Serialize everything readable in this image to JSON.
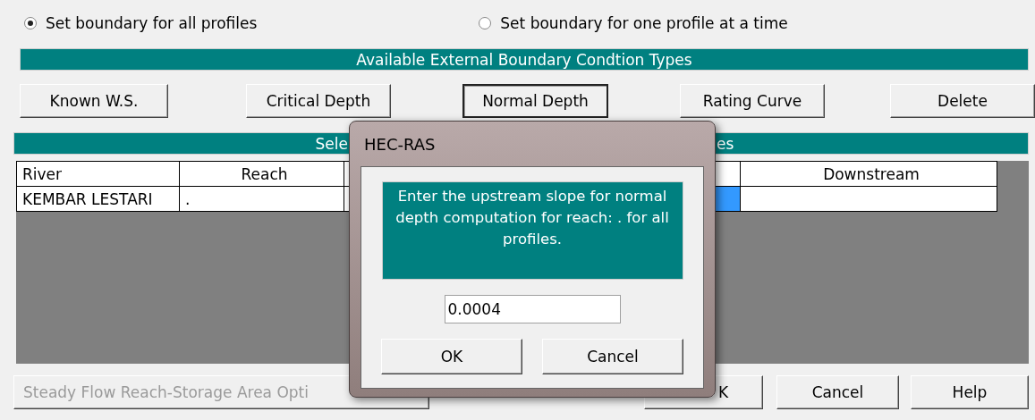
{
  "boundary_mode": [
    {
      "label": "Set boundary for all profiles",
      "selected": true
    },
    {
      "label": "Set boundary for one profile at a time",
      "selected": false
    }
  ],
  "types_header": "Available External Boundary Condtion Types",
  "type_buttons": [
    {
      "label": "Known W.S.",
      "pressed": false
    },
    {
      "label": "Critical Depth",
      "pressed": false
    },
    {
      "label": "Normal Depth",
      "pressed": true
    },
    {
      "label": "Rating Curve",
      "pressed": false
    },
    {
      "label": "Delete",
      "pressed": false
    }
  ],
  "locations_header": {
    "left": "Sele",
    "right": "es"
  },
  "table": {
    "columns": [
      "River",
      "Reach",
      "",
      "Downstream"
    ],
    "rows": [
      {
        "cells": [
          "KEMBAR LESTARI",
          "."
        ],
        "selected": true
      }
    ]
  },
  "bottom_buttons": [
    {
      "label": "Steady Flow Reach-Storage Area Opti",
      "disabled": true
    },
    {
      "label": "K",
      "disabled": false
    },
    {
      "label": "Cancel",
      "disabled": false
    },
    {
      "label": "Help",
      "disabled": false
    }
  ],
  "dialog": {
    "title": "HEC-RAS",
    "message": "Enter the upstream slope for normal depth computation for reach: .   for all profiles.",
    "value": "0.0004",
    "buttons": [
      "OK",
      "Cancel"
    ]
  }
}
